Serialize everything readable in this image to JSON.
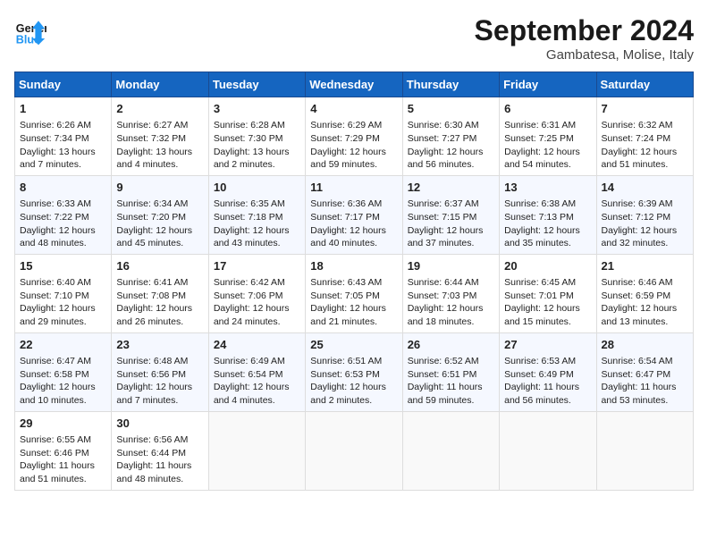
{
  "header": {
    "logo_line1": "General",
    "logo_line2": "Blue",
    "month": "September 2024",
    "location": "Gambatesa, Molise, Italy"
  },
  "days_of_week": [
    "Sunday",
    "Monday",
    "Tuesday",
    "Wednesday",
    "Thursday",
    "Friday",
    "Saturday"
  ],
  "weeks": [
    [
      {
        "day": "1",
        "text": "Sunrise: 6:26 AM\nSunset: 7:34 PM\nDaylight: 13 hours\nand 7 minutes."
      },
      {
        "day": "2",
        "text": "Sunrise: 6:27 AM\nSunset: 7:32 PM\nDaylight: 13 hours\nand 4 minutes."
      },
      {
        "day": "3",
        "text": "Sunrise: 6:28 AM\nSunset: 7:30 PM\nDaylight: 13 hours\nand 2 minutes."
      },
      {
        "day": "4",
        "text": "Sunrise: 6:29 AM\nSunset: 7:29 PM\nDaylight: 12 hours\nand 59 minutes."
      },
      {
        "day": "5",
        "text": "Sunrise: 6:30 AM\nSunset: 7:27 PM\nDaylight: 12 hours\nand 56 minutes."
      },
      {
        "day": "6",
        "text": "Sunrise: 6:31 AM\nSunset: 7:25 PM\nDaylight: 12 hours\nand 54 minutes."
      },
      {
        "day": "7",
        "text": "Sunrise: 6:32 AM\nSunset: 7:24 PM\nDaylight: 12 hours\nand 51 minutes."
      }
    ],
    [
      {
        "day": "8",
        "text": "Sunrise: 6:33 AM\nSunset: 7:22 PM\nDaylight: 12 hours\nand 48 minutes."
      },
      {
        "day": "9",
        "text": "Sunrise: 6:34 AM\nSunset: 7:20 PM\nDaylight: 12 hours\nand 45 minutes."
      },
      {
        "day": "10",
        "text": "Sunrise: 6:35 AM\nSunset: 7:18 PM\nDaylight: 12 hours\nand 43 minutes."
      },
      {
        "day": "11",
        "text": "Sunrise: 6:36 AM\nSunset: 7:17 PM\nDaylight: 12 hours\nand 40 minutes."
      },
      {
        "day": "12",
        "text": "Sunrise: 6:37 AM\nSunset: 7:15 PM\nDaylight: 12 hours\nand 37 minutes."
      },
      {
        "day": "13",
        "text": "Sunrise: 6:38 AM\nSunset: 7:13 PM\nDaylight: 12 hours\nand 35 minutes."
      },
      {
        "day": "14",
        "text": "Sunrise: 6:39 AM\nSunset: 7:12 PM\nDaylight: 12 hours\nand 32 minutes."
      }
    ],
    [
      {
        "day": "15",
        "text": "Sunrise: 6:40 AM\nSunset: 7:10 PM\nDaylight: 12 hours\nand 29 minutes."
      },
      {
        "day": "16",
        "text": "Sunrise: 6:41 AM\nSunset: 7:08 PM\nDaylight: 12 hours\nand 26 minutes."
      },
      {
        "day": "17",
        "text": "Sunrise: 6:42 AM\nSunset: 7:06 PM\nDaylight: 12 hours\nand 24 minutes."
      },
      {
        "day": "18",
        "text": "Sunrise: 6:43 AM\nSunset: 7:05 PM\nDaylight: 12 hours\nand 21 minutes."
      },
      {
        "day": "19",
        "text": "Sunrise: 6:44 AM\nSunset: 7:03 PM\nDaylight: 12 hours\nand 18 minutes."
      },
      {
        "day": "20",
        "text": "Sunrise: 6:45 AM\nSunset: 7:01 PM\nDaylight: 12 hours\nand 15 minutes."
      },
      {
        "day": "21",
        "text": "Sunrise: 6:46 AM\nSunset: 6:59 PM\nDaylight: 12 hours\nand 13 minutes."
      }
    ],
    [
      {
        "day": "22",
        "text": "Sunrise: 6:47 AM\nSunset: 6:58 PM\nDaylight: 12 hours\nand 10 minutes."
      },
      {
        "day": "23",
        "text": "Sunrise: 6:48 AM\nSunset: 6:56 PM\nDaylight: 12 hours\nand 7 minutes."
      },
      {
        "day": "24",
        "text": "Sunrise: 6:49 AM\nSunset: 6:54 PM\nDaylight: 12 hours\nand 4 minutes."
      },
      {
        "day": "25",
        "text": "Sunrise: 6:51 AM\nSunset: 6:53 PM\nDaylight: 12 hours\nand 2 minutes."
      },
      {
        "day": "26",
        "text": "Sunrise: 6:52 AM\nSunset: 6:51 PM\nDaylight: 11 hours\nand 59 minutes."
      },
      {
        "day": "27",
        "text": "Sunrise: 6:53 AM\nSunset: 6:49 PM\nDaylight: 11 hours\nand 56 minutes."
      },
      {
        "day": "28",
        "text": "Sunrise: 6:54 AM\nSunset: 6:47 PM\nDaylight: 11 hours\nand 53 minutes."
      }
    ],
    [
      {
        "day": "29",
        "text": "Sunrise: 6:55 AM\nSunset: 6:46 PM\nDaylight: 11 hours\nand 51 minutes."
      },
      {
        "day": "30",
        "text": "Sunrise: 6:56 AM\nSunset: 6:44 PM\nDaylight: 11 hours\nand 48 minutes."
      },
      {
        "day": "",
        "text": ""
      },
      {
        "day": "",
        "text": ""
      },
      {
        "day": "",
        "text": ""
      },
      {
        "day": "",
        "text": ""
      },
      {
        "day": "",
        "text": ""
      }
    ]
  ]
}
